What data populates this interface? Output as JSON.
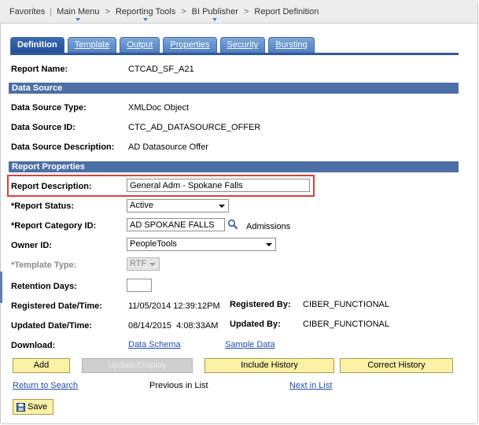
{
  "breadcrumb": {
    "items": [
      "Favorites",
      "Main Menu",
      "Reporting Tools",
      "BI Publisher",
      "Report Definition"
    ]
  },
  "tabs": [
    "Definition",
    "Template",
    "Output",
    "Properties",
    "Security",
    "Bursting"
  ],
  "report_name": {
    "label": "Report Name:",
    "value": "CTCAD_SF_A21"
  },
  "data_source": {
    "header": "Data Source",
    "type_label": "Data Source Type:",
    "type_value": "XMLDoc Object",
    "id_label": "Data Source ID:",
    "id_value": "CTC_AD_DATASOURCE_OFFER",
    "desc_label": "Data Source Description:",
    "desc_value": "AD Datasource Offer"
  },
  "report_properties": {
    "header": "Report Properties",
    "description_label": "Report Description:",
    "description_value": "General Adm - Spokane Falls",
    "status_label": "*Report Status:",
    "status_value": "Active",
    "category_label": "*Report Category ID:",
    "category_value": "AD SPOKANE FALLS",
    "category_desc": "Admissions",
    "owner_label": "Owner ID:",
    "owner_value": "PeopleTools",
    "template_type_label": "*Template Type:",
    "template_type_value": "RTF",
    "retention_label": "Retention Days:",
    "retention_value": "",
    "registered_label": "Registered Date/Time:",
    "registered_value": "11/05/2014 12:39:12PM",
    "registered_by_label": "Registered By:",
    "registered_by_value": "CIBER_FUNCTIONAL",
    "updated_label": "Updated Date/Time:",
    "updated_value": "08/14/2015  4:08:33AM",
    "updated_by_label": "Updated By:",
    "updated_by_value": "CIBER_FUNCTIONAL",
    "download_label": "Download:",
    "data_schema_link": "Data Schema",
    "sample_data_link": "Sample Data"
  },
  "buttons": {
    "add": "Add",
    "update_display": "Update/Display",
    "include_history": "Include History",
    "correct_history": "Correct History",
    "save": "Save"
  },
  "nav": {
    "return_to_search": "Return to Search",
    "previous": "Previous in List",
    "next": "Next in List"
  }
}
